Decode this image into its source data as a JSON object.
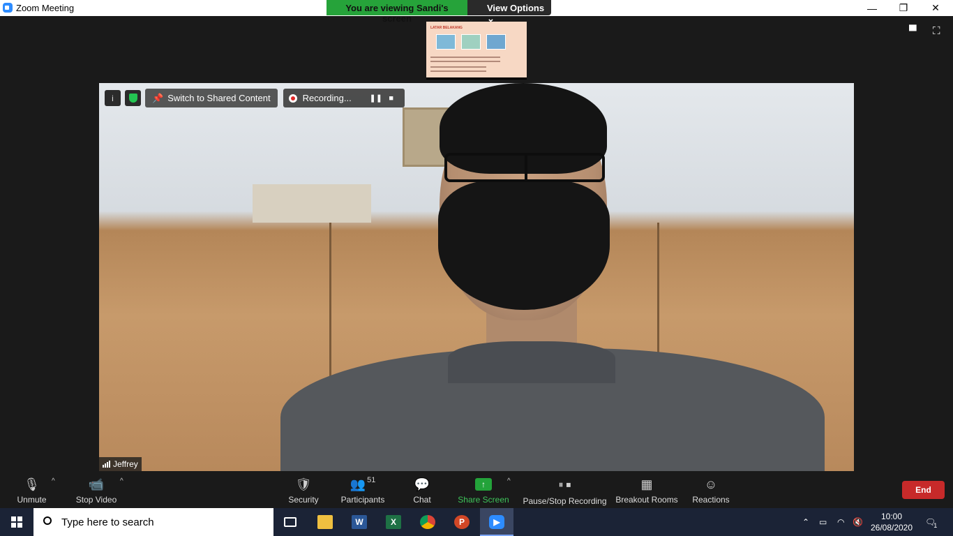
{
  "window": {
    "title": "Zoom Meeting",
    "minimize": "—",
    "restore": "❐",
    "close": "✕"
  },
  "banner": {
    "viewing": "You are viewing Sandi's screen",
    "view_options": "View Options ⌄"
  },
  "shared_thumbnail": {
    "title": "LATAR BELAKANG"
  },
  "video_toolbar": {
    "info_icon": "i",
    "switch_label": "Switch to Shared Content",
    "recording_label": "Recording...",
    "pause_glyph": "❚❚",
    "stop_glyph": "■"
  },
  "speaker": {
    "name": "Jeffrey"
  },
  "controls": {
    "unmute": "Unmute",
    "stop_video": "Stop Video",
    "security": "Security",
    "participants": "Participants",
    "participants_count": "51",
    "chat": "Chat",
    "share_screen": "Share Screen",
    "pause_stop_recording": "Pause/Stop Recording",
    "breakout_rooms": "Breakout Rooms",
    "reactions": "Reactions",
    "end": "End",
    "caret": "^"
  },
  "taskbar": {
    "search_placeholder": "Type here to search",
    "time": "10:00",
    "date": "26/08/2020",
    "notifications_count": "1",
    "apps": [
      "task-view",
      "file-explorer",
      "word",
      "excel",
      "chrome",
      "powerpoint",
      "zoom"
    ]
  },
  "colors": {
    "zoom_blue": "#2d8cff",
    "green": "#23a33a",
    "end_red": "#c72a2a",
    "taskbar": "#1b2336"
  }
}
